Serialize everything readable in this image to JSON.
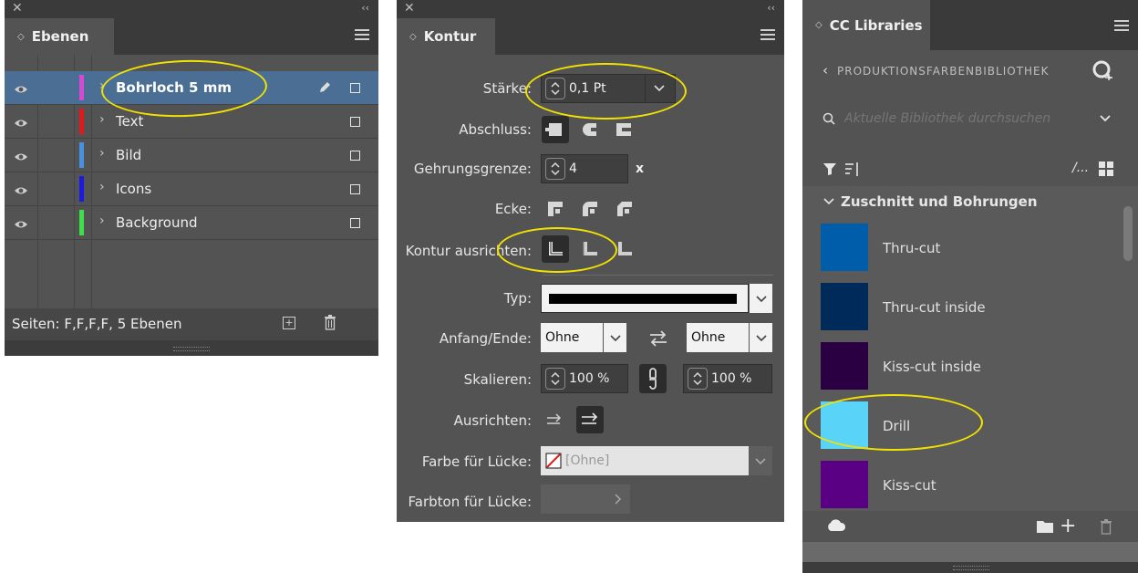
{
  "layers_panel": {
    "tab_title": "Ebenen",
    "layers": [
      {
        "name": "Bohrloch 5 mm",
        "color": "#d24bd6",
        "selected": true
      },
      {
        "name": "Text",
        "color": "#e01919",
        "selected": false
      },
      {
        "name": "Bild",
        "color": "#4a90e2",
        "selected": false
      },
      {
        "name": "Icons",
        "color": "#1a1ae0",
        "selected": false
      },
      {
        "name": "Background",
        "color": "#3ee04a",
        "selected": false
      }
    ],
    "footer_text": "Seiten: F,F,F,F, 5 Ebenen"
  },
  "stroke_panel": {
    "tab_title": "Kontur",
    "weight_label": "Stärke:",
    "weight_value": "0,1 Pt",
    "cap_label": "Abschluss:",
    "miter_label": "Gehrungsgrenze:",
    "miter_value": "4",
    "miter_suffix": "x",
    "corner_label": "Ecke:",
    "align_label": "Kontur ausrichten:",
    "type_label": "Typ:",
    "start_end_label": "Anfang/Ende:",
    "start_value": "Ohne",
    "end_value": "Ohne",
    "scale_label": "Skalieren:",
    "scale_start": "100 %",
    "scale_end": "100 %",
    "align_arrows_label": "Ausrichten:",
    "gap_color_label": "Farbe für Lücke:",
    "gap_color_value": "[Ohne]",
    "gap_tint_label": "Farbton für Lücke:"
  },
  "libraries_panel": {
    "tab_title": "CC Libraries",
    "library_name": "PRODUKTIONSFARBENBIBLIOTHEK",
    "search_placeholder": "Aktuelle Bibliothek durchsuchen",
    "group_title": "Zuschnitt und Bohrungen",
    "swatches": [
      {
        "name": "Thru-cut",
        "color": "#005daa"
      },
      {
        "name": "Thru-cut inside",
        "color": "#002a5a"
      },
      {
        "name": "Kiss-cut inside",
        "color": "#2b0043"
      },
      {
        "name": "Drill",
        "color": "#59d3f7"
      },
      {
        "name": "Kiss-cut",
        "color": "#5a0085"
      }
    ]
  },
  "highlight_color": "#f2e200"
}
